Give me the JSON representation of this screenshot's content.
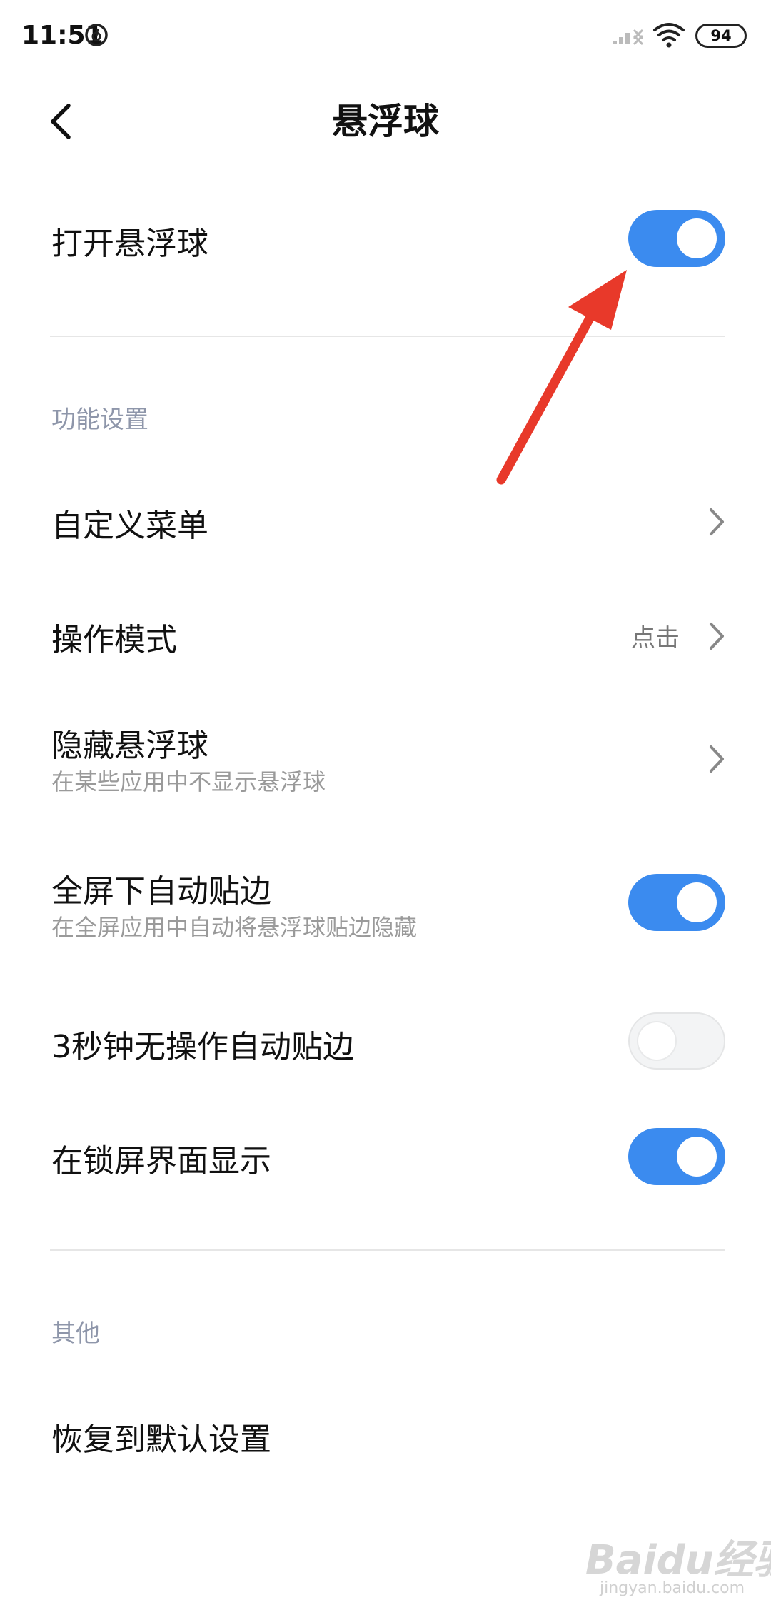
{
  "status_bar": {
    "time": "11:51",
    "battery": "94",
    "icons": [
      "netease-music-icon",
      "signal-off-icon",
      "wifi-icon",
      "battery-icon"
    ]
  },
  "header": {
    "title": "悬浮球",
    "back_icon": "chevron-left-icon"
  },
  "main_toggle": {
    "label": "打开悬浮球",
    "enabled": true
  },
  "sections": [
    {
      "header": "功能设置",
      "items": [
        {
          "label": "自定义菜单",
          "type": "link"
        },
        {
          "label": "操作模式",
          "type": "link",
          "value": "点击"
        },
        {
          "label": "隐藏悬浮球",
          "sublabel": "在某些应用中不显示悬浮球",
          "type": "link"
        },
        {
          "label": "全屏下自动贴边",
          "sublabel": "在全屏应用中自动将悬浮球贴边隐藏",
          "type": "toggle",
          "enabled": true
        },
        {
          "label": "3秒钟无操作自动贴边",
          "type": "toggle",
          "enabled": false
        },
        {
          "label": "在锁屏界面显示",
          "type": "toggle",
          "enabled": true
        }
      ]
    },
    {
      "header": "其他",
      "items": [
        {
          "label": "恢复到默认设置",
          "type": "action"
        }
      ]
    }
  ],
  "annotation": {
    "type": "red-arrow",
    "color": "#e8392a",
    "points_to": "main_toggle"
  },
  "watermark": {
    "text": "Baidu经验",
    "sub": "jingyan.baidu.com"
  },
  "colors": {
    "toggle_on": "#3b8bef",
    "toggle_off": "#f3f4f5",
    "section_header": "#8e96aa",
    "sublabel": "#9a9a9a"
  }
}
